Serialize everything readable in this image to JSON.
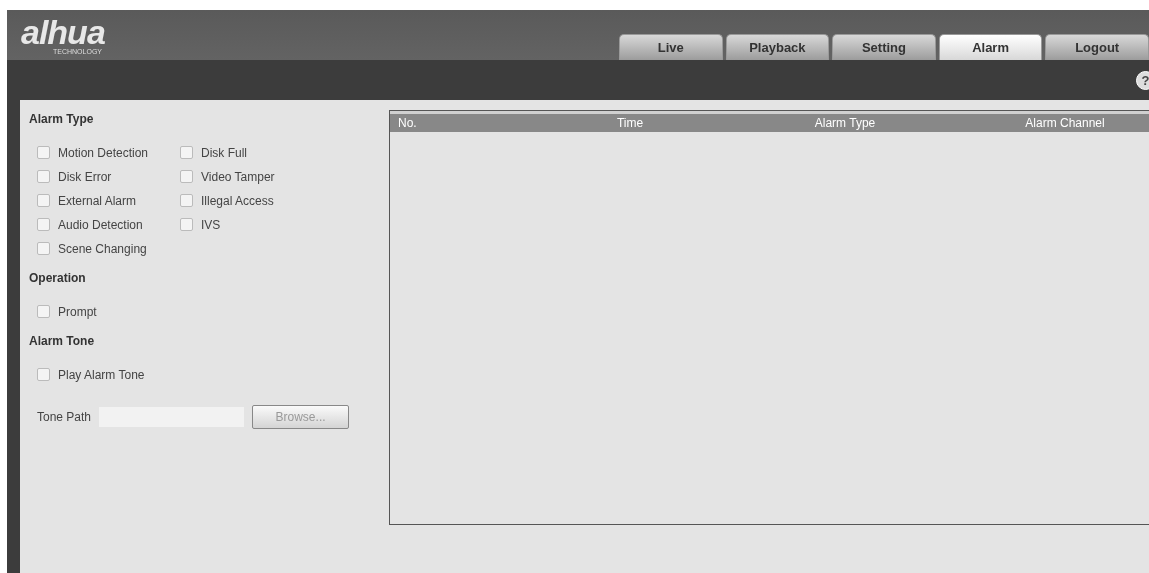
{
  "logo": {
    "brand": "alhua",
    "tagline": "TECHNOLOGY"
  },
  "tabs": [
    {
      "label": "Live",
      "selected": false
    },
    {
      "label": "Playback",
      "selected": false
    },
    {
      "label": "Setting",
      "selected": false
    },
    {
      "label": "Alarm",
      "selected": true
    },
    {
      "label": "Logout",
      "selected": false
    }
  ],
  "help": {
    "label": "?"
  },
  "sections": [
    {
      "title": "Alarm Type",
      "options": [
        {
          "label": "Motion Detection",
          "checked": false
        },
        {
          "label": "Disk Full",
          "checked": false
        },
        {
          "label": "Disk Error",
          "checked": false
        },
        {
          "label": "Video Tamper",
          "checked": false
        },
        {
          "label": "External Alarm",
          "checked": false
        },
        {
          "label": "Illegal Access",
          "checked": false
        },
        {
          "label": "Audio Detection",
          "checked": false
        },
        {
          "label": "IVS",
          "checked": false
        },
        {
          "label": "Scene Changing",
          "checked": false
        }
      ]
    },
    {
      "title": "Operation",
      "options": [
        {
          "label": "Prompt",
          "checked": false
        }
      ]
    },
    {
      "title": "Alarm Tone",
      "options": [
        {
          "label": "Play Alarm Tone",
          "checked": false
        }
      ]
    }
  ],
  "tone_path": {
    "label": "Tone Path",
    "button": "Browse..."
  },
  "table": {
    "columns": [
      "No.",
      "Time",
      "Alarm Type",
      "Alarm Channel"
    ]
  }
}
